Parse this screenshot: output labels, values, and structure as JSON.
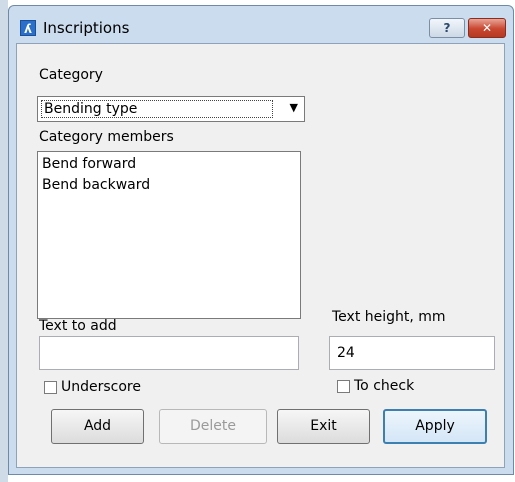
{
  "window": {
    "title": "Inscriptions",
    "app_icon": "app-logo-icon",
    "help_glyph": "?",
    "close_glyph": "✕"
  },
  "category": {
    "label": "Category",
    "selected": "Bending type",
    "arrow": "▼"
  },
  "members": {
    "label": "Category members",
    "items": [
      "Bend forward",
      "Bend backward"
    ]
  },
  "text_to_add": {
    "label": "Text to add",
    "value": ""
  },
  "text_height": {
    "label": "Text height, mm",
    "value": "24"
  },
  "underscore": {
    "label": "Underscore",
    "checked": false
  },
  "to_check": {
    "label": "To check",
    "checked": false
  },
  "buttons": {
    "add": "Add",
    "delete": "Delete",
    "exit": "Exit",
    "apply": "Apply"
  }
}
